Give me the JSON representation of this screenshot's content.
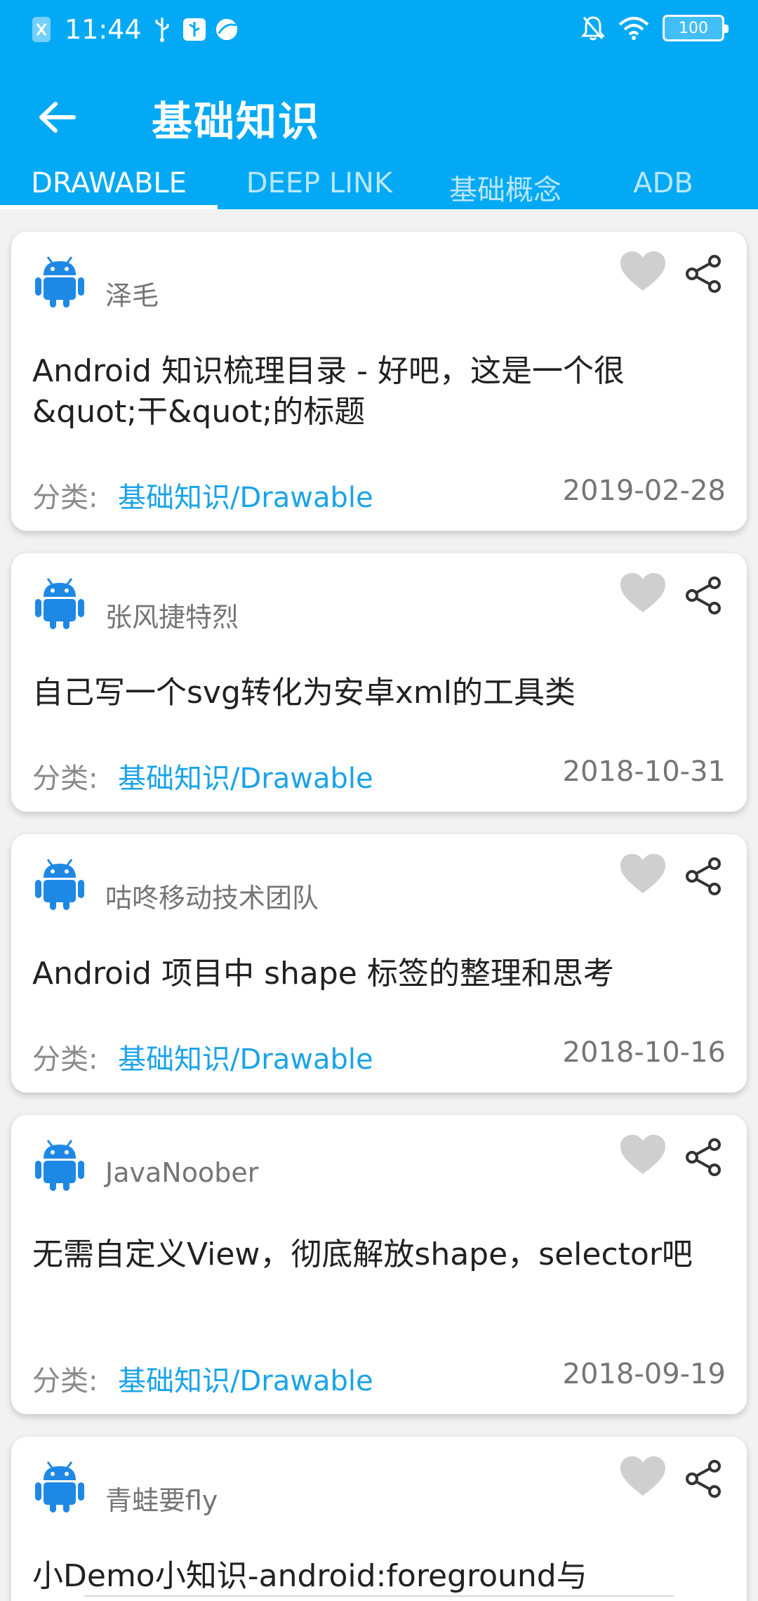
{
  "status_bar": {
    "time": "11:44",
    "battery": "100",
    "left_icons": [
      "notification-icon",
      "usb-icon",
      "usb-debug-icon",
      "browser-icon"
    ],
    "right_icons": [
      "mute-bell-icon",
      "wifi-icon"
    ]
  },
  "toolbar": {
    "title": "基础知识",
    "back_icon": "arrow-back-icon"
  },
  "tabs": [
    {
      "label": "DRAWABLE",
      "active": true
    },
    {
      "label": "DEEP LINK",
      "active": false
    },
    {
      "label": "基础概念",
      "active": false
    },
    {
      "label": "ADB",
      "active": false
    }
  ],
  "colors": {
    "primary": "#03a9f4",
    "link": "#1aa3e8",
    "android_blue": "#1e88e5",
    "like_gray": "#cfcfcf",
    "background": "#f2f2f2"
  },
  "category_label": "分类:",
  "articles": [
    {
      "author": "泽毛",
      "title": "Android 知识梳理目录 - 好吧，这是一个很&quot;干&quot;的标题",
      "category": "基础知识/Drawable",
      "date": "2019-02-28"
    },
    {
      "author": "张风捷特烈",
      "title": "自己写一个svg转化为安卓xml的工具类",
      "category": "基础知识/Drawable",
      "date": "2018-10-31"
    },
    {
      "author": "咕咚移动技术团队",
      "title": "Android 项目中 shape 标签的整理和思考",
      "category": "基础知识/Drawable",
      "date": "2018-10-16"
    },
    {
      "author": "JavaNoober",
      "title": "无需自定义View，彻底解放shape，selector吧",
      "category": "基础知识/Drawable",
      "date": "2018-09-19"
    },
    {
      "author": "青蛙要fly",
      "title": "小Demo小知识-android:foreground与",
      "category": "",
      "date": ""
    }
  ]
}
